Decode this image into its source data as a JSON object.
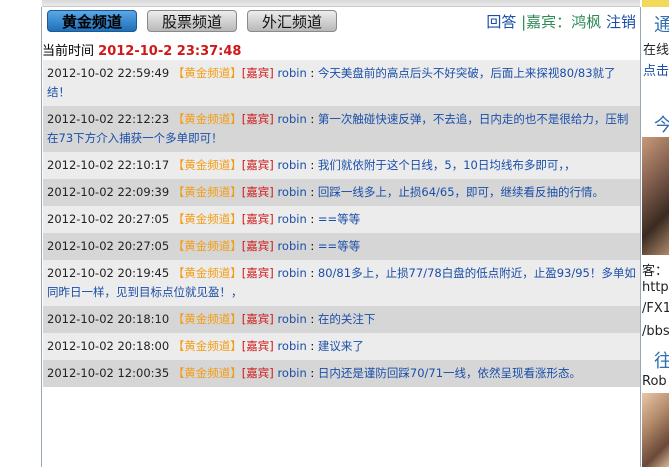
{
  "nav": {
    "tabs": [
      {
        "label": "黄金频道",
        "active": true
      },
      {
        "label": "股票频道",
        "active": false
      },
      {
        "label": "外汇频道",
        "active": false
      }
    ],
    "reply": "回答",
    "separator": "|",
    "guest_label": "嘉宾：",
    "guest_name": "鸿枫",
    "logout": "注销"
  },
  "time_row": {
    "label": "当前时间",
    "value": "2012-10-2 23:37:48"
  },
  "messages": [
    {
      "ts": "2012-10-02 22:59:49",
      "channel": "【黄金频道】",
      "tag": "[嘉宾]",
      "user": "robin",
      "text": "今天美盘前的高点后头不好突破，后面上来探视80/83就了结！"
    },
    {
      "ts": "2012-10-02 22:12:23",
      "channel": "【黄金频道】",
      "tag": "[嘉宾]",
      "user": "robin",
      "text": "第一次触碰快速反弹，不去追，日内走的也不是很给力，压制在73下方介入捕获一个多单即可！"
    },
    {
      "ts": "2012-10-02 22:10:17",
      "channel": "【黄金频道】",
      "tag": "[嘉宾]",
      "user": "robin",
      "text": "我们就依附于这个日线，5，10日均线布多即可，，"
    },
    {
      "ts": "2012-10-02 22:09:39",
      "channel": "【黄金频道】",
      "tag": "[嘉宾]",
      "user": "robin",
      "text": "回踩一线多上，止损64/65，即可，继续看反抽的行情。"
    },
    {
      "ts": "2012-10-02 20:27:05",
      "channel": "【黄金频道】",
      "tag": "[嘉宾]",
      "user": "robin",
      "text": "==等等"
    },
    {
      "ts": "2012-10-02 20:27:05",
      "channel": "【黄金频道】",
      "tag": "[嘉宾]",
      "user": "robin",
      "text": "==等等"
    },
    {
      "ts": "2012-10-02 20:19:45",
      "channel": "【黄金频道】",
      "tag": "[嘉宾]",
      "user": "robin",
      "text": "80/81多上，止损77/78白盘的低点附近，止盈93/95！多单如同昨日一样，见到目标点位就见盈！，"
    },
    {
      "ts": "2012-10-02 20:18:10",
      "channel": "【黄金频道】",
      "tag": "[嘉宾]",
      "user": "robin",
      "text": "在的关注下"
    },
    {
      "ts": "2012-10-02 20:18:00",
      "channel": "【黄金频道】",
      "tag": "[嘉宾]",
      "user": "robin",
      "text": "建议来了"
    },
    {
      "ts": "2012-10-02 12:00:35",
      "channel": "【黄金频道】",
      "tag": "[嘉宾]",
      "user": "robin",
      "text": "日内还是谨防回踩70/71一线，依然呈现看涨形态。"
    }
  ],
  "sidebar": {
    "title1": "通",
    "online": "在线",
    "click": "点击",
    "title2": "今",
    "guest": "客：",
    "link1": "http:",
    "link2": "/FX1",
    "link3": "/bbs",
    "title3": "往",
    "name": "Rob"
  },
  "colors": {
    "accent_blue": "#1a4ea8",
    "channel_orange": "#f39c12",
    "tag_red": "#d01818",
    "row_light": "#ececec",
    "row_dark": "#d6d6d6"
  }
}
